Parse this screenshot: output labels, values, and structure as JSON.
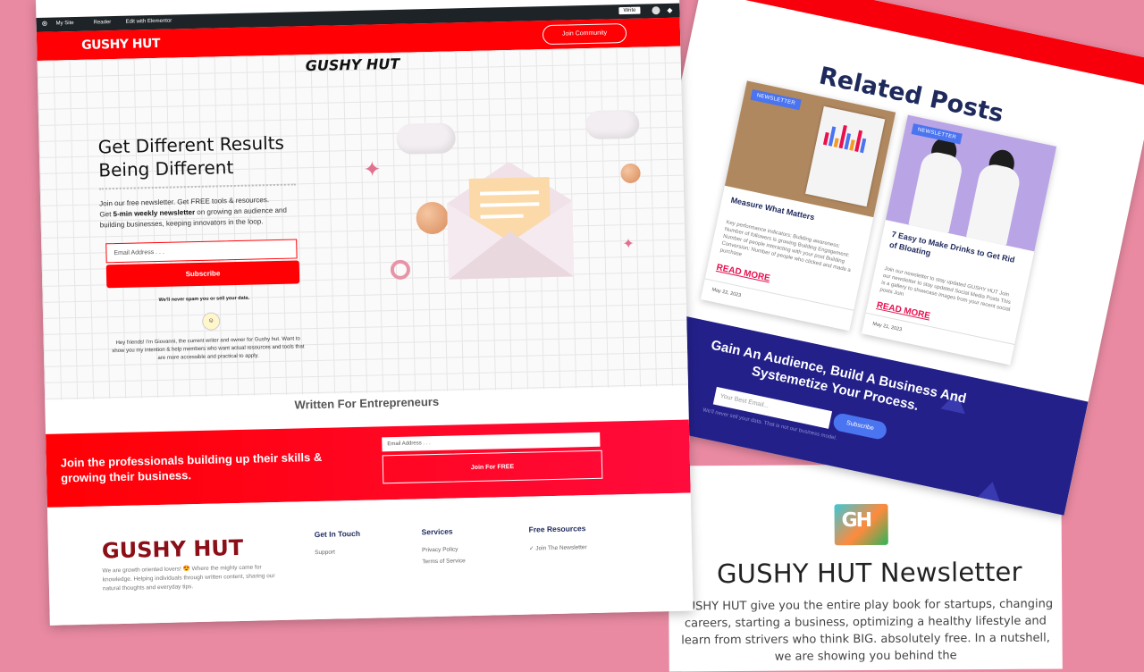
{
  "colors": {
    "background": "#e98aa2",
    "brand_red": "#ff0004",
    "navy": "#23208a",
    "accent_blue": "#4a74f0"
  },
  "main": {
    "admin_bar": {
      "my_site": "My Site",
      "reader": "Reader",
      "edit": "Edit with Elementor",
      "write": "Write"
    },
    "header": {
      "logo": "GUSHY HUT",
      "join_button": "Join Community"
    },
    "hero": {
      "brand": "GUSHY HUT",
      "title": "Get Different Results Being Different",
      "intro_1": "Join our free newsletter. Get FREE tools & resources.",
      "intro_2": "Get ",
      "intro_bold": "5-min weekly newsletter",
      "intro_3": " on growing an audience and building businesses, keeping innovators in the loop.",
      "email_placeholder": "Email Address . . .",
      "subscribe": "Subscribe",
      "no_spam": "We'll never spam you or sell your data.",
      "bio": "Hey friends! I'm Giovanni, the current writer and owner for Gushy hut. Want to show you my intention & help members who want actual resources and tools that are more accessible and practical to apply."
    },
    "section_title": "Written For Entrepreneurs",
    "cta_band": {
      "text": "Join the professionals building up their skills & growing their business.",
      "email_placeholder": "Email Address . . .",
      "button": "Join For FREE"
    },
    "footer": {
      "logo": "GUSHY HUT",
      "desc": "We are growth oriented lovers! 😍 Where the mighty came for knowledge. Helping individuals through written content, sharing our natural thoughts and everyday tips.",
      "col1": {
        "title": "Get In Touch",
        "links": [
          "Support"
        ]
      },
      "col2": {
        "title": "Services",
        "links": [
          "Privacy Policy",
          "Terms of Service"
        ]
      },
      "col3": {
        "title": "Free Resources",
        "links": [
          "Join The Newsletter"
        ]
      }
    }
  },
  "related": {
    "title": "Related Posts",
    "posts": [
      {
        "tag": "NEWSLETTER",
        "title": "Measure What Matters",
        "excerpt": "Key performance indicators: Building awareness: Number of followers is growing Building Engagement: Number of people interacting with your post Building Conversion: Number of people who clicked and made a purchase",
        "more": "READ MORE",
        "date": "May 22, 2023"
      },
      {
        "tag": "NEWSLETTER",
        "title": "7 Easy to Make Drinks to Get Rid of Bloating",
        "excerpt": "Join our newsletter to stay updated GUSHY HUT Join our newsletter to stay updated Social Media Posts This is a gallery to showcase images from your recent social posts Join",
        "more": "READ MORE",
        "date": "May 21, 2023"
      }
    ],
    "band": {
      "title": "Gain An Audience, Build A Business And Systemetize Your Process.",
      "email_placeholder": "Your Best Email...",
      "button": "Subscribe",
      "note": "We'll never sell your data. That is not our business model."
    }
  },
  "newsletter": {
    "title": "GUSHY HUT Newsletter",
    "text": "GUSHY HUT give you the entire play book for startups, changing careers, starting a business, optimizing a healthy lifestyle and learn from strivers who think BIG. absolutely free. In a nutshell, we are showing you behind the"
  }
}
